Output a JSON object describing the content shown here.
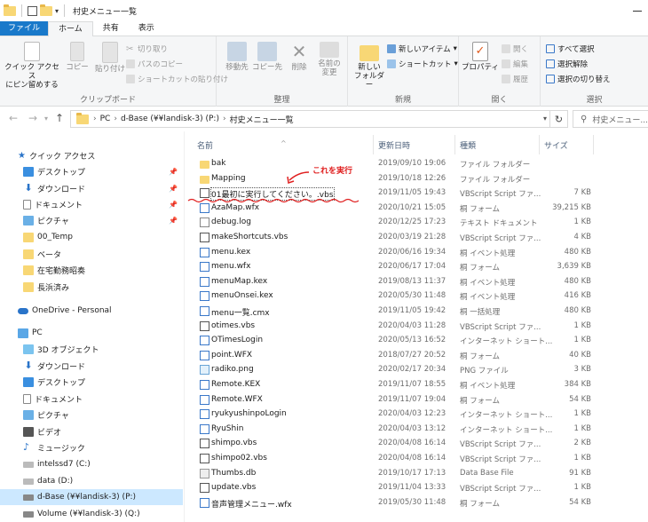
{
  "window": {
    "title": "村史メニュー一覧"
  },
  "ribbon_tabs": [
    "ファイル",
    "ホーム",
    "共有",
    "表示"
  ],
  "ribbon": {
    "clipboard": {
      "label": "クリップボード",
      "pin": "クイック アクセス\nにピン留めする",
      "copy": "コピー",
      "paste": "貼り付け",
      "cut": "切り取り",
      "copy_path": "パスのコピー",
      "paste_shortcut": "ショートカットの貼り付け"
    },
    "organize": {
      "label": "整理",
      "move_to": "移動先",
      "copy_to": "コピー先",
      "delete": "削除",
      "rename": "名前の\n変更"
    },
    "new": {
      "label": "新規",
      "new_folder": "新しい\nフォルダー",
      "new_item": "新しいアイテム",
      "shortcut": "ショートカット"
    },
    "open": {
      "label": "開く",
      "properties": "プロパティ",
      "open": "開く",
      "edit": "編集",
      "history": "履歴"
    },
    "select": {
      "label": "選択",
      "select_all": "すべて選択",
      "select_none": "選択解除",
      "invert": "選択の切り替え"
    }
  },
  "address": {
    "crumbs": [
      "PC",
      "d-Base (¥¥landisk-3) (P:)",
      "村史メニュー一覧"
    ],
    "search_placeholder": "村史メニュー..."
  },
  "nav": {
    "quick_access": "クイック アクセス",
    "quick_items": [
      "デスクトップ",
      "ダウンロード",
      "ドキュメント",
      "ピクチャ",
      "00_Temp",
      "ベータ",
      "在宅勤務昭奏",
      "長浜済み"
    ],
    "onedrive": "OneDrive - Personal",
    "pc": "PC",
    "pc_items": [
      "3D オブジェクト",
      "ダウンロード",
      "デスクトップ",
      "ドキュメント",
      "ピクチャ",
      "ビデオ",
      "ミュージック",
      "intelssd7 (C:)",
      "data (D:)",
      "d-Base (¥¥landisk-3) (P:)",
      "Volume (¥¥landisk-3) (Q:)"
    ]
  },
  "columns": {
    "name": "名前",
    "date": "更新日時",
    "type": "種類",
    "size": "サイズ"
  },
  "annotation": "これを実行",
  "files": [
    {
      "name": "bak",
      "date": "2019/09/10 19:06",
      "type": "ファイル フォルダー",
      "size": "",
      "icon": "folder"
    },
    {
      "name": "Mapping",
      "date": "2019/10/18 12:26",
      "type": "ファイル フォルダー",
      "size": "",
      "icon": "folder"
    },
    {
      "name": "01最初に実行してください。.vbs",
      "date": "2019/11/05 19:43",
      "type": "VBScript Script ファ...",
      "size": "7 KB",
      "icon": "vbs"
    },
    {
      "name": "AzaMap.wfx",
      "date": "2020/10/21 15:05",
      "type": "桐 フォーム",
      "size": "39,215 KB",
      "icon": "wfx"
    },
    {
      "name": "debug.log",
      "date": "2020/12/25 17:23",
      "type": "テキスト ドキュメント",
      "size": "1 KB",
      "icon": "txt"
    },
    {
      "name": "makeShortcuts.vbs",
      "date": "2020/03/19 21:28",
      "type": "VBScript Script ファ...",
      "size": "4 KB",
      "icon": "vbs"
    },
    {
      "name": "menu.kex",
      "date": "2020/06/16 19:34",
      "type": "桐 イベント処理",
      "size": "480 KB",
      "icon": "kex"
    },
    {
      "name": "menu.wfx",
      "date": "2020/06/17 17:04",
      "type": "桐 フォーム",
      "size": "3,639 KB",
      "icon": "wfx"
    },
    {
      "name": "menuMap.kex",
      "date": "2019/08/13 11:37",
      "type": "桐 イベント処理",
      "size": "480 KB",
      "icon": "kex"
    },
    {
      "name": "menuOnsei.kex",
      "date": "2020/05/30 11:48",
      "type": "桐 イベント処理",
      "size": "416 KB",
      "icon": "kex"
    },
    {
      "name": "menu一覧.cmx",
      "date": "2019/11/05 19:42",
      "type": "桐 一括処理",
      "size": "480 KB",
      "icon": "cmx"
    },
    {
      "name": "otimes.vbs",
      "date": "2020/04/03 11:28",
      "type": "VBScript Script ファ...",
      "size": "1 KB",
      "icon": "vbs"
    },
    {
      "name": "OTimesLogin",
      "date": "2020/05/13 16:52",
      "type": "インターネット ショート...",
      "size": "1 KB",
      "icon": "url"
    },
    {
      "name": "point.WFX",
      "date": "2018/07/27 20:52",
      "type": "桐 フォーム",
      "size": "40 KB",
      "icon": "wfx"
    },
    {
      "name": "radiko.png",
      "date": "2020/02/17 20:34",
      "type": "PNG ファイル",
      "size": "3 KB",
      "icon": "png"
    },
    {
      "name": "Remote.KEX",
      "date": "2019/11/07 18:55",
      "type": "桐 イベント処理",
      "size": "384 KB",
      "icon": "kex"
    },
    {
      "name": "Remote.WFX",
      "date": "2019/11/07 19:04",
      "type": "桐 フォーム",
      "size": "54 KB",
      "icon": "wfx"
    },
    {
      "name": "ryukyushinpoLogin",
      "date": "2020/04/03 12:23",
      "type": "インターネット ショート...",
      "size": "1 KB",
      "icon": "url"
    },
    {
      "name": "RyuShin",
      "date": "2020/04/03 13:12",
      "type": "インターネット ショート...",
      "size": "1 KB",
      "icon": "url"
    },
    {
      "name": "shimpo.vbs",
      "date": "2020/04/08 16:14",
      "type": "VBScript Script ファ...",
      "size": "2 KB",
      "icon": "vbs"
    },
    {
      "name": "shimpo02.vbs",
      "date": "2020/04/08 16:14",
      "type": "VBScript Script ファ...",
      "size": "1 KB",
      "icon": "vbs"
    },
    {
      "name": "Thumbs.db",
      "date": "2019/10/17 17:13",
      "type": "Data Base File",
      "size": "91 KB",
      "icon": "db"
    },
    {
      "name": "update.vbs",
      "date": "2019/11/04 13:33",
      "type": "VBScript Script ファ...",
      "size": "1 KB",
      "icon": "vbs"
    },
    {
      "name": "音声管理メニュー.wfx",
      "date": "2019/05/30 11:48",
      "type": "桐 フォーム",
      "size": "54 KB",
      "icon": "wfx"
    }
  ]
}
